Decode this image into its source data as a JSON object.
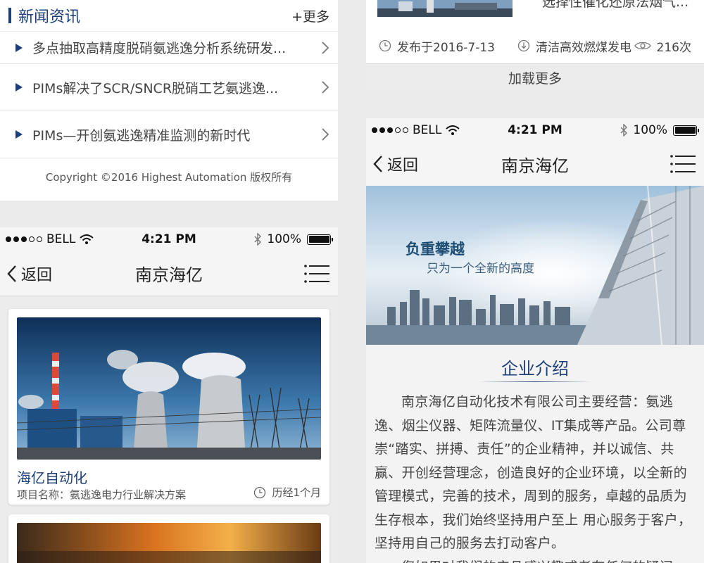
{
  "news": {
    "title": "新闻资讯",
    "more": "+更多",
    "items": [
      "多点抽取高精度脱硝氨逃逸分析系统研发...",
      "PIMs解决了SCR/SNCR脱硝工艺氨逃逸...",
      "PIMs—开创氨逃逸精准监测的新时代"
    ],
    "copyright": "Copyright ©2016 Highest Automation 版权所有"
  },
  "article_list": {
    "partial_text": "选择性催化还原法烟气...",
    "published": "发布于2016-7-13",
    "category": "清洁高效燃煤发电",
    "views": "216次",
    "load_more": "加载更多"
  },
  "status_bar": {
    "carrier": "BELL",
    "time": "4:21 PM",
    "battery": "100%",
    "battery_level": 1.0
  },
  "nav": {
    "back": "返回",
    "title": "南京海亿"
  },
  "project": {
    "card_title": "海亿自动化",
    "card_desc": "项目名称：氨逃逸电力行业解决方案",
    "card_time": "历经1个月"
  },
  "company": {
    "banner_heading": "负重攀越",
    "banner_sub": "只为一个全新的高度",
    "section_title": "企业介绍",
    "intro": "南京海亿自动化技术有限公司主要经营：氨逃逸、烟尘仪器、矩阵流量仪、IT集成等产品。公司尊崇“踏实、拼搏、责任”的企业精神，并以诚信、共赢、开创经营理念，创造良好的企业环境，以全新的管理模式，完善的技术，周到的服务，卓越的品质为生存根本，我们始终坚持用户至上 用心服务于客户，坚持用自己的服务去打动客户。",
    "intro_2": "您如果对我们的产品感兴趣或者有任何的疑问"
  },
  "colors": {
    "brand_blue": "#1c3f7a",
    "page_bg": "#ebebeb",
    "text_gray": "#444444"
  }
}
